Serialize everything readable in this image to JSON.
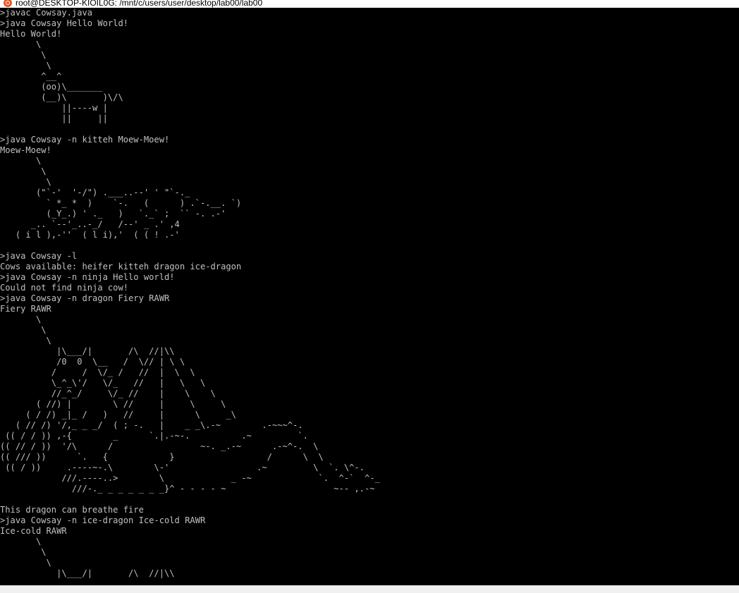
{
  "window": {
    "title": "root@DESKTOP-KIOIL0G: /mnt/c/users/user/desktop/lab00/lab00"
  },
  "colors": {
    "background": "#000000",
    "text": "#c0c0c0",
    "titlebar": "#ffffff",
    "ubuntu_icon": "#e95420"
  },
  "icons": {
    "title_icon": "ubuntu-icon"
  },
  "terminal": {
    "lines": [
      ">javac Cowsay.java",
      ">java Cowsay Hello World!",
      "Hello World!",
      "       \\",
      "        \\",
      "         \\",
      "        ^__^",
      "        (oo)\\_______",
      "        (__)\\       )\\/\\",
      "            ||----w |",
      "            ||     ||",
      "",
      ">java Cowsay -n kitteh Moew-Moew!",
      "Moew-Moew!",
      "       \\",
      "        \\",
      "         \\",
      "       (\"`-'  '-/\") .___..--' ' \"`-._",
      "         ` *_ *  )    `-.   (      ) .`-.__. `)",
      "         (_Y_.) ' ._   )   `._` ;  `` -. .-'",
      "      _.. `--'_..-_/   /--' _ .' ,4",
      "   ( i l ),-''  ( l i),'  ( ( ! .-'",
      "",
      ">java Cowsay -l",
      "Cows available: heifer kitteh dragon ice-dragon",
      ">java Cowsay -n ninja Hello world!",
      "Could not find ninja cow!",
      ">java Cowsay -n dragon Fiery RAWR",
      "Fiery RAWR",
      "       \\",
      "        \\",
      "         \\",
      "           |\\___/|       /\\  //|\\\\",
      "           /0  0  \\__   /  \\// | \\ \\",
      "          /     /  \\/_ /   //  |  \\  \\",
      "          \\_^_\\'/   \\/_   //   |   \\   \\",
      "          //_^_/     \\/_ //    |    \\    \\",
      "       ( //) |        \\ //     |     \\     \\",
      "     ( / /) _|_ /   )   //     |      \\     _\\",
      "   ( // /) '/,_ _ _/  ( ; -.   |    _ _\\.-~        .-~~~^-.",
      " (( / / )) ,-{        _      `.|.-~-.          .~         `.",
      "(( // / ))  '/\\      /                 ~-. _.-~      .-~^-.  \\",
      "(( /// ))      `.   {            }                  /      \\  \\",
      " (( / ))     .----~-.\\        \\-'                 .~         \\  `. \\^-.",
      "            ///.----..>        \\             _ -~             `.  ^-`  ^-_",
      "              ///-._ _ _ _ _ _ _}^ - - - - ~                     ~-- ,.-~",
      "",
      "This dragon can breathe fire",
      ">java Cowsay -n ice-dragon Ice-cold RAWR",
      "Ice-cold RAWR",
      "       \\",
      "        \\",
      "         \\",
      "           |\\___/|       /\\  //|\\\\",
      "."
    ]
  }
}
